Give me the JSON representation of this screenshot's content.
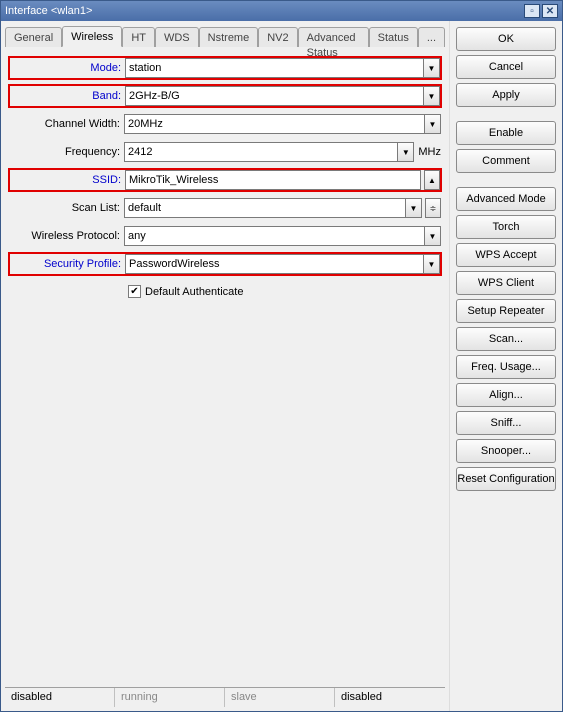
{
  "window": {
    "title": "Interface <wlan1>"
  },
  "tabs": {
    "items": [
      "General",
      "Wireless",
      "HT",
      "WDS",
      "Nstreme",
      "NV2",
      "Advanced Status",
      "Status",
      "..."
    ],
    "active_index": 1
  },
  "form": {
    "mode": {
      "label": "Mode:",
      "value": "station"
    },
    "band": {
      "label": "Band:",
      "value": "2GHz-B/G"
    },
    "channel_width": {
      "label": "Channel Width:",
      "value": "20MHz"
    },
    "frequency": {
      "label": "Frequency:",
      "value": "2412",
      "unit": "MHz"
    },
    "ssid": {
      "label": "SSID:",
      "value": "MikroTik_Wireless"
    },
    "scan_list": {
      "label": "Scan List:",
      "value": "default"
    },
    "wireless_protocol": {
      "label": "Wireless Protocol:",
      "value": "any"
    },
    "security_profile": {
      "label": "Security Profile:",
      "value": "PasswordWireless"
    },
    "default_authenticate": {
      "label": "Default Authenticate",
      "checked": true
    }
  },
  "buttons": {
    "ok": "OK",
    "cancel": "Cancel",
    "apply": "Apply",
    "enable": "Enable",
    "comment": "Comment",
    "advanced_mode": "Advanced Mode",
    "torch": "Torch",
    "wps_accept": "WPS Accept",
    "wps_client": "WPS Client",
    "setup_repeater": "Setup Repeater",
    "scan": "Scan...",
    "freq_usage": "Freq. Usage...",
    "align": "Align...",
    "sniff": "Sniff...",
    "snooper": "Snooper...",
    "reset_configuration": "Reset Configuration"
  },
  "status": {
    "c1": "disabled",
    "c2": "running",
    "c3": "slave",
    "c4": "disabled"
  }
}
